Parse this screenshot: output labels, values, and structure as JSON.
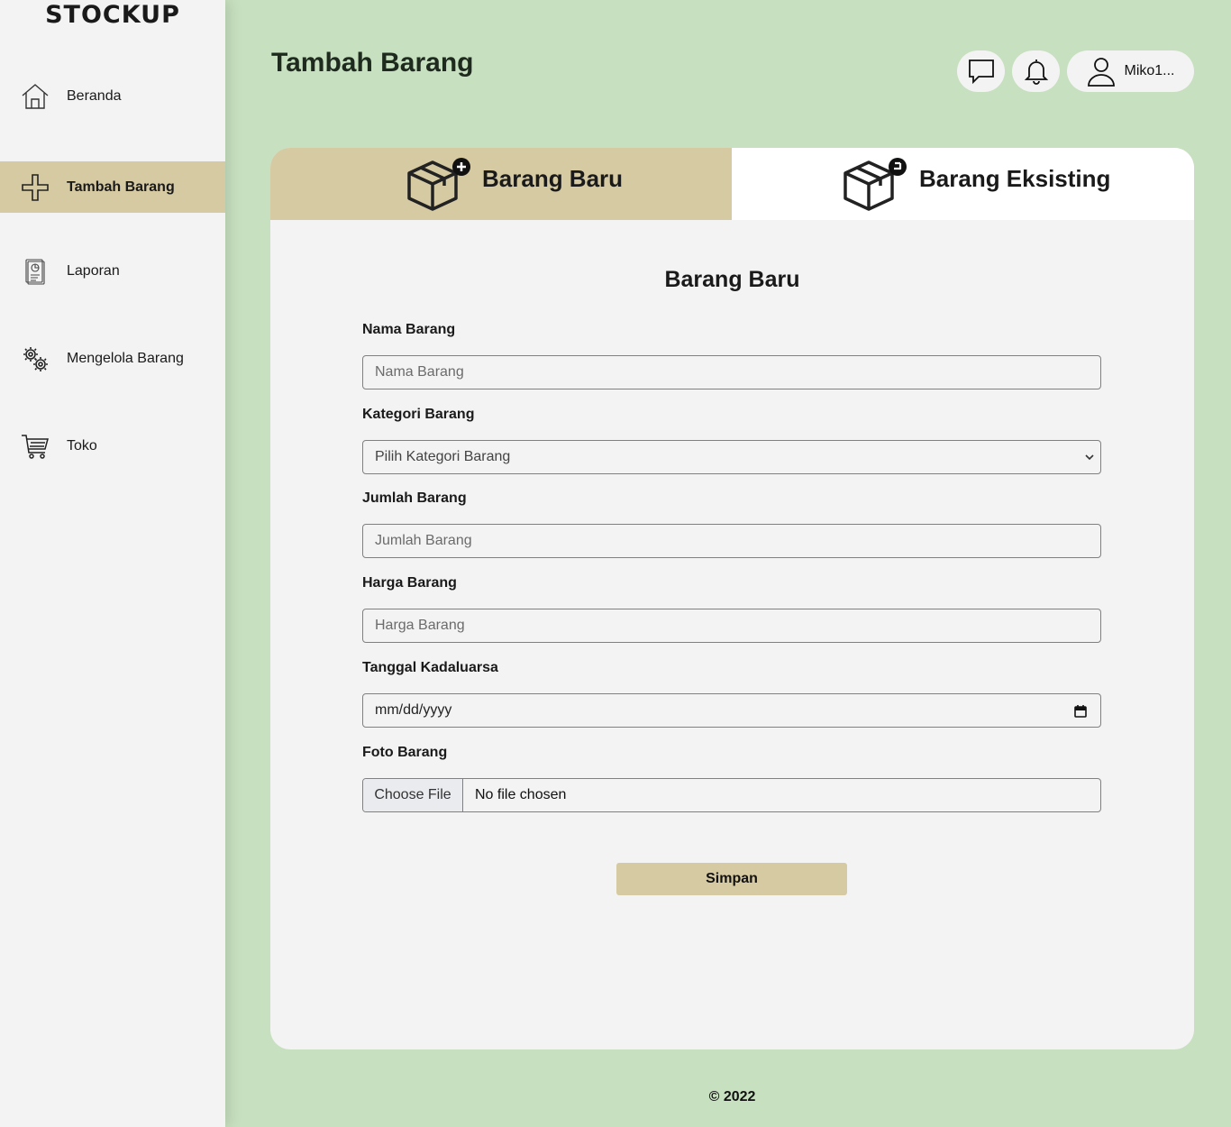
{
  "brand": "STOCKUP",
  "sidebar": {
    "items": [
      {
        "label": "Beranda",
        "icon": "home-icon"
      },
      {
        "label": "Tambah Barang",
        "icon": "plus-icon",
        "active": true
      },
      {
        "label": "Laporan",
        "icon": "report-icon"
      },
      {
        "label": "Mengelola Barang",
        "icon": "gears-icon"
      },
      {
        "label": "Toko",
        "icon": "cart-icon"
      }
    ]
  },
  "header": {
    "title": "Tambah Barang",
    "chat_icon": "chat-icon",
    "bell_icon": "bell-icon",
    "user_name": "Miko1..."
  },
  "tabs": [
    {
      "label": "Barang Baru",
      "icon": "box-add-icon",
      "active": true
    },
    {
      "label": "Barang Eksisting",
      "icon": "box-existing-icon",
      "active": false
    }
  ],
  "form": {
    "title": "Barang Baru",
    "nama_label": "Nama Barang",
    "nama_placeholder": "Nama Barang",
    "kategori_label": "Kategori Barang",
    "kategori_value": "Pilih Kategori Barang",
    "jumlah_label": "Jumlah Barang",
    "jumlah_placeholder": "Jumlah Barang",
    "harga_label": "Harga Barang",
    "harga_placeholder": "Harga Barang",
    "tanggal_label": "Tanggal Kadaluarsa",
    "tanggal_value": "mm/dd/yyyy",
    "foto_label": "Foto Barang",
    "file_button": "Choose File",
    "file_status": "No file chosen",
    "save_label": "Simpan"
  },
  "footer": "© 2022",
  "colors": {
    "background": "#c7e0bf",
    "sidebar": "#f3f3f3",
    "accent": "#d6caa3",
    "card": "#f3f3f3"
  }
}
